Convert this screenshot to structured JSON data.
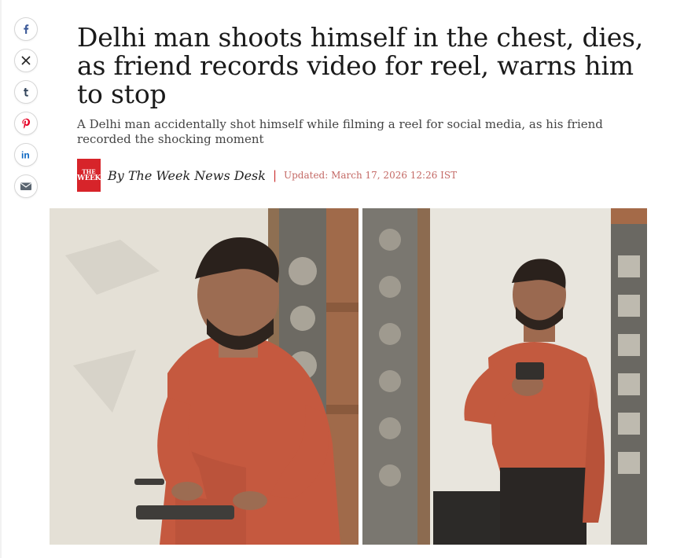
{
  "article": {
    "headline": "Delhi man shoots himself in the chest, dies, as friend records video for reel, warns him to stop",
    "summary": "A Delhi man accidentally shot himself while filming a reel for social media, as his friend recorded the shocking moment",
    "byline": {
      "logo_text_top": "THE",
      "logo_text_bottom": "WEEK",
      "author": "By The Week News Desk",
      "separator": "|",
      "updated": "Updated: March 17, 2026 12:26 IST"
    }
  },
  "share": {
    "icons": [
      "facebook-icon",
      "x-icon",
      "tumblr-icon",
      "pinterest-icon",
      "linkedin-icon",
      "email-icon"
    ]
  },
  "colors": {
    "brand_red": "#d7242a",
    "share_blue": "#3b5998",
    "pinterest_red": "#e60023",
    "linkedin_blue": "#0a66c2"
  }
}
